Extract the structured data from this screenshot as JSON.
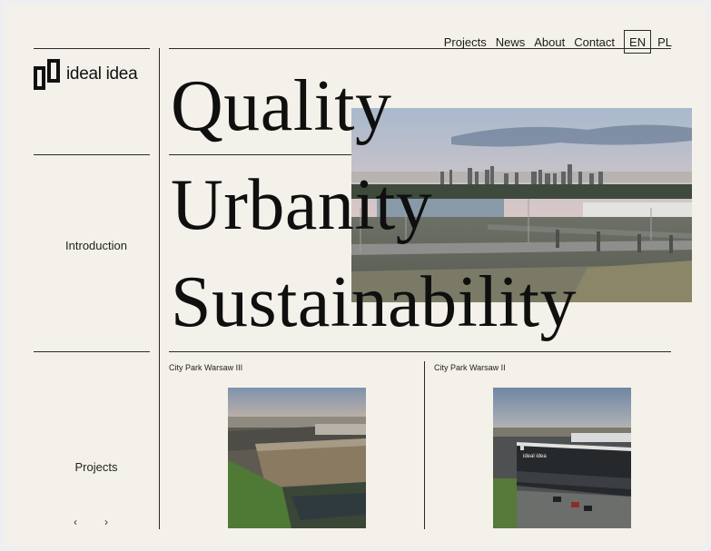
{
  "brand": {
    "name": "ideal idea"
  },
  "nav": {
    "links": [
      "Projects",
      "News",
      "About",
      "Contact"
    ],
    "languages": [
      "EN",
      "PL"
    ],
    "active_language": "EN"
  },
  "sidebar": {
    "introduction_label": "Introduction",
    "projects_label": "Projects",
    "prev_arrow": "‹",
    "next_arrow": "›"
  },
  "hero": {
    "words": [
      "Quality",
      "Urbanity",
      "Sustainability"
    ]
  },
  "projects": [
    {
      "title": "City Park Warsaw III"
    },
    {
      "title": "City Park Warsaw II",
      "sign_text": "ideal idea"
    }
  ],
  "colors": {
    "background": "#f4f1ea",
    "rule": "#2a2a2a",
    "text": "#1b1b1b"
  }
}
